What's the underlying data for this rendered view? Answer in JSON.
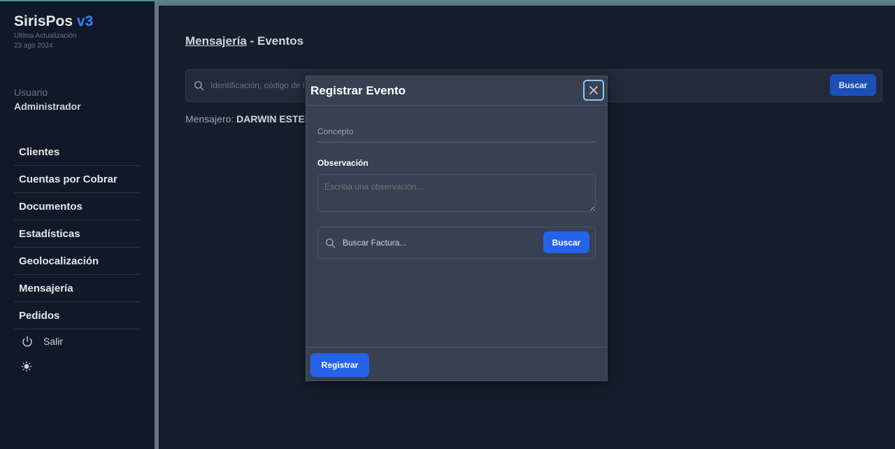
{
  "app": {
    "name": "SirisPos",
    "version": "v3",
    "update_label": "Ultima Actualización",
    "update_date": "23 ago 2024"
  },
  "user": {
    "label": "Usuario",
    "name": "Administrador"
  },
  "sidebar": {
    "items": [
      {
        "label": "Clientes"
      },
      {
        "label": "Cuentas por Cobrar"
      },
      {
        "label": "Documentos"
      },
      {
        "label": "Estadísticas"
      },
      {
        "label": "Geolocalización"
      },
      {
        "label": "Mensajería"
      },
      {
        "label": "Pedidos"
      }
    ],
    "logout_label": "Salir",
    "logout_icon": "power-icon",
    "theme_icon": "sun-icon"
  },
  "page": {
    "title_link": "Mensajería",
    "title_rest": " - Eventos",
    "search_placeholder": "Identificación, código de l",
    "search_button": "Buscar",
    "messenger_label": "Mensajero:",
    "messenger_name": "DARWIN ESTEBA"
  },
  "modal": {
    "title": "Registrar Evento",
    "concepto_placeholder": "Concepto",
    "observacion_label": "Observación",
    "observacion_placeholder": "Escriba una observación...",
    "factura_placeholder": "Buscar Factura...",
    "factura_button": "Buscar",
    "register_button": "Registrar"
  },
  "colors": {
    "accent": "#2563eb",
    "brand_version": "#3b82f6",
    "modal_bg": "#374151",
    "page_bg": "#161e2c",
    "sidebar_bg": "#111827"
  }
}
